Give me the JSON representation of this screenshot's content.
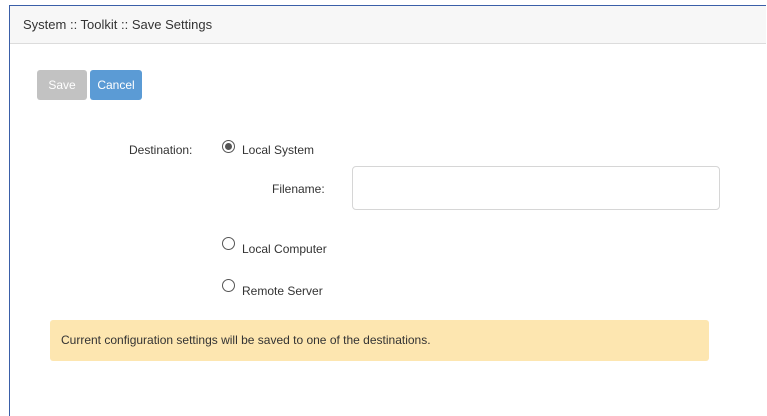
{
  "header": {
    "breadcrumb": "System :: Toolkit :: Save Settings"
  },
  "toolbar": {
    "save_label": "Save",
    "cancel_label": "Cancel",
    "save_enabled": false
  },
  "form": {
    "destination_label": "Destination:",
    "filename_label": "Filename:",
    "filename_value": "",
    "selected_destination": "local_system",
    "options": [
      {
        "id": "local_system",
        "label": "Local System",
        "checked": true
      },
      {
        "id": "local_computer",
        "label": "Local Computer",
        "checked": false
      },
      {
        "id": "remote_server",
        "label": "Remote Server",
        "checked": false
      }
    ]
  },
  "notice": {
    "text": "Current configuration settings will be saved to one of the destinations."
  },
  "colors": {
    "panel_border": "#3a5fa8",
    "header_bg": "#f7f7f7",
    "save_disabled": "#c2c2c2",
    "cancel_bg": "#5b9bd5",
    "notice_bg": "#fde6b0"
  }
}
